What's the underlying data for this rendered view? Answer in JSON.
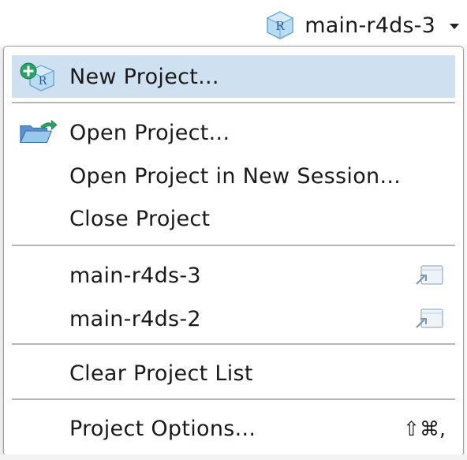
{
  "header": {
    "project_name": "main-r4ds-3",
    "project_icon": "r-project-cube-icon",
    "dropdown_icon": "caret-down-icon"
  },
  "menu": {
    "items": [
      {
        "label": "New Project...",
        "icon": "new-project-icon",
        "selected": true
      },
      {
        "label": "Open Project...",
        "icon": "open-folder-icon"
      },
      {
        "label": "Open Project in New Session..."
      },
      {
        "label": "Close Project"
      },
      {
        "label": "main-r4ds-3",
        "icon": "open-in-new-window-icon"
      },
      {
        "label": "main-r4ds-2",
        "icon": "open-in-new-window-icon"
      },
      {
        "label": "Clear Project List"
      },
      {
        "label": "Project Options...",
        "shortcut": "⇧⌘,"
      }
    ]
  },
  "colors": {
    "selected_bg": "#cfe0f1",
    "separator": "#b5b5b5",
    "accent_green": "#2aa36b",
    "cube_blue": "#8fc3e6"
  }
}
